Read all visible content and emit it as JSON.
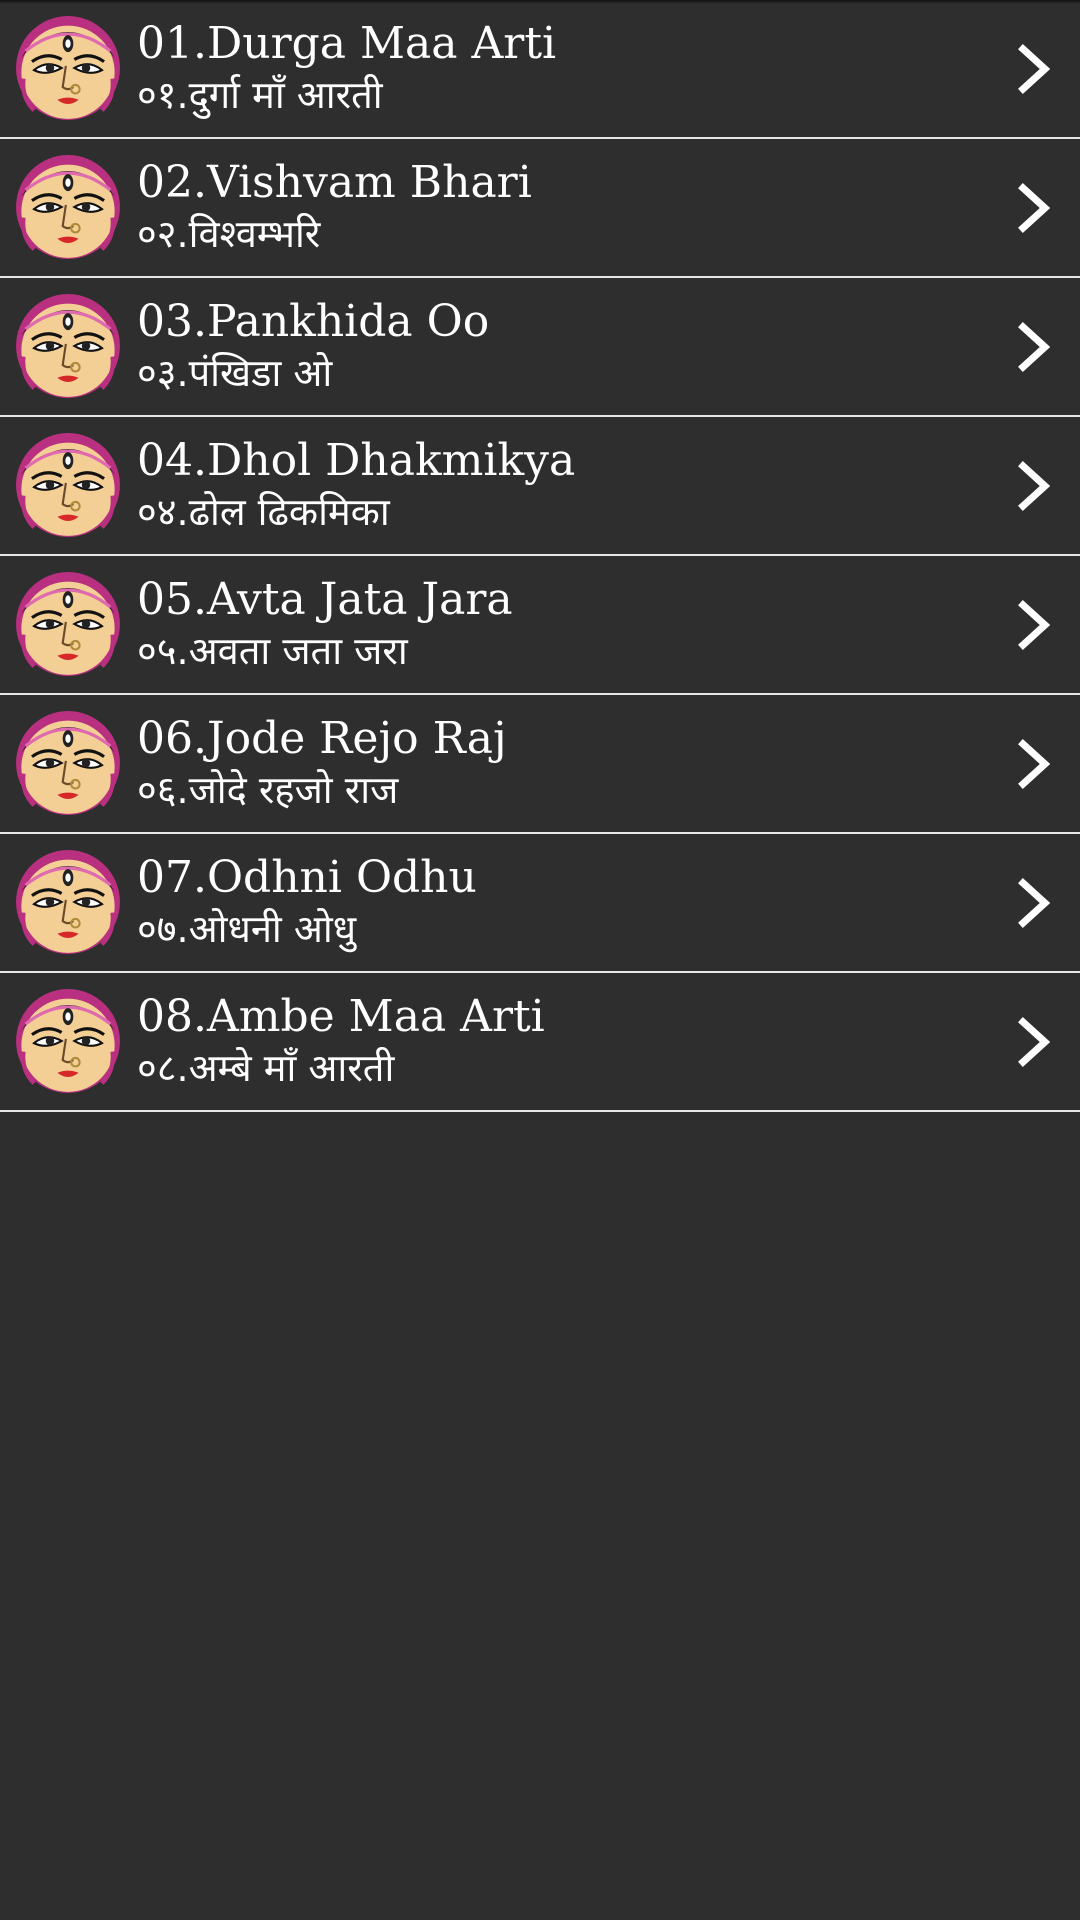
{
  "theme": {
    "background": "#2e2e2e",
    "divider": "#e6e6e6",
    "text": "#ffffff",
    "chevron_color": "#ffffff"
  },
  "list": {
    "item_icon": "goddess-durga-face-icon",
    "trailing_icon": "chevron-right-icon",
    "items": [
      {
        "title": "01.Durga Maa Arti",
        "subtitle": "०१.दुर्गा माँ आरती"
      },
      {
        "title": "02.Vishvam Bhari",
        "subtitle": "०२.विश्वम्भरि"
      },
      {
        "title": "03.Pankhida Oo",
        "subtitle": "०३.पंखिडा ओ"
      },
      {
        "title": "04.Dhol Dhakmikya",
        "subtitle": "०४.ढोल ढिकमिका"
      },
      {
        "title": "05.Avta Jata Jara",
        "subtitle": "०५.अवता जता जरा"
      },
      {
        "title": "06.Jode Rejo Raj",
        "subtitle": "०६.जोदे रहजो राज"
      },
      {
        "title": "07.Odhni Odhu",
        "subtitle": "०७.ओधनी ओधु"
      },
      {
        "title": "08.Ambe Maa Arti",
        "subtitle": "०८.अम्बे माँ आरती"
      }
    ]
  }
}
